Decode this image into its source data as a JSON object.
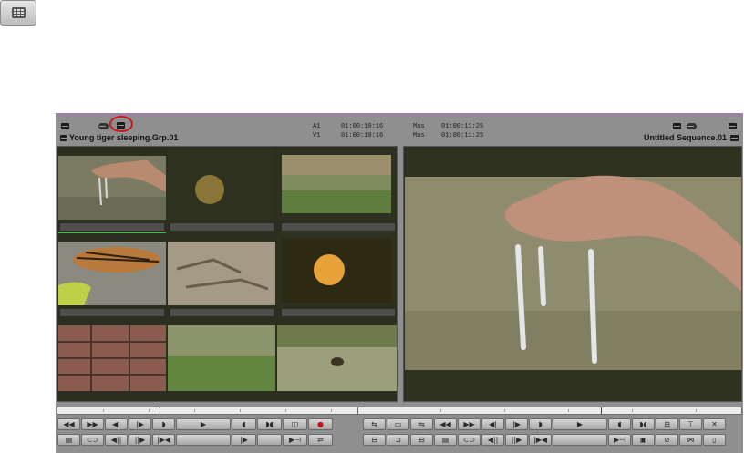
{
  "multicam_toggle": {
    "icon": "grid-icon"
  },
  "source_monitor": {
    "clip_title": "Young tiger sleeping.Grp.01",
    "tc_labels": [
      "A1",
      "V1"
    ],
    "tc_values": [
      "01:00:10:16",
      "01:00:10:16"
    ],
    "highlight_color": "#cc1a1a",
    "tiles": [
      {
        "name": "hand-water-clip"
      },
      {
        "name": "dim-moon-clip"
      },
      {
        "name": "grassland-clip"
      },
      {
        "name": "sleeping-tiger-clip"
      },
      {
        "name": "dry-leaves-clip"
      },
      {
        "name": "bright-moon-clip"
      },
      {
        "name": "wooden-planks-clip"
      },
      {
        "name": "green-field-clip"
      },
      {
        "name": "animal-in-water-clip"
      }
    ]
  },
  "record_monitor": {
    "sequence_title": "Untitled Sequence.01",
    "mas_labels": [
      "Mas",
      "Mas"
    ],
    "mas_values": [
      "01:00:11:25",
      "01:00:11:25"
    ]
  },
  "controls": {
    "source_row1": [
      "◀◀",
      "▶▶",
      "◀|",
      "|▶",
      "◗",
      "▶",
      "◖",
      "◗◖",
      "◫",
      "●"
    ],
    "source_row2": [
      "▤",
      "⊂⊃",
      "◀||",
      "||▶",
      "|▶◀",
      "",
      "|▶",
      "",
      "▶⊣",
      "⇌"
    ],
    "record_row1": [
      "⇆",
      "▭",
      "⇋",
      "◀◀",
      "▶▶",
      "◀|",
      "|▶",
      "◗",
      "▶",
      "◖",
      "◗◖",
      "⊟",
      "⊤",
      "✕"
    ],
    "record_row2": [
      "⊟",
      "⊐",
      "⊟",
      "▤",
      "⊂⊃",
      "◀||",
      "||▶",
      "|▶◀",
      "",
      "▶⊣",
      "▣",
      "⊘",
      "⋈",
      "▯"
    ],
    "accent_red": "#cc1010"
  }
}
